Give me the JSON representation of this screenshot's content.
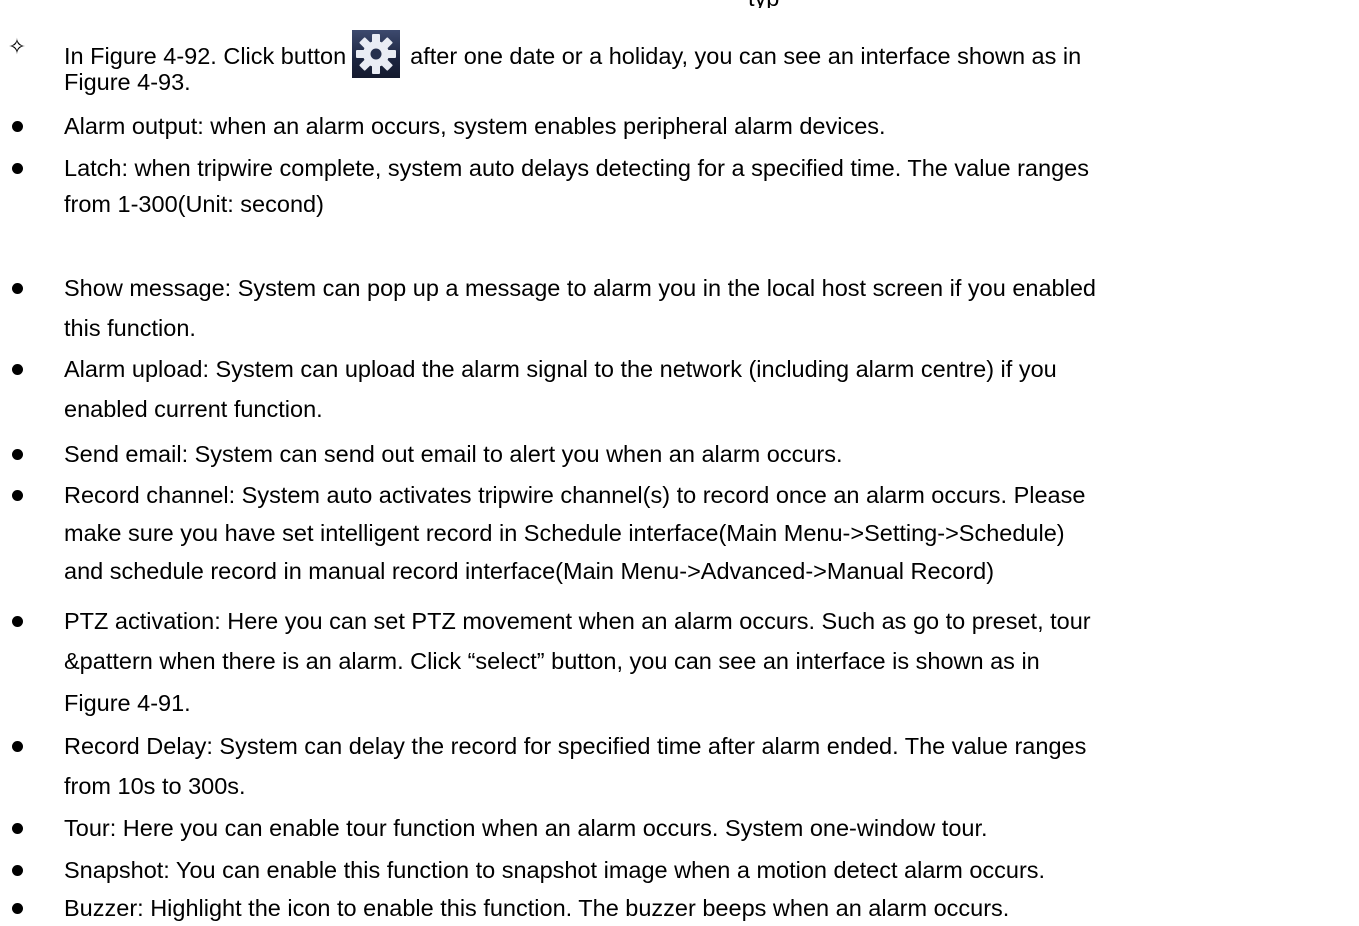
{
  "header_fragment": "typ",
  "intro": {
    "marker": "✧",
    "before_icon": "In Figure 4-92. Click button",
    "icon": "gear-icon",
    "after_icon": "after one date or a holiday, you can see an interface shown as in",
    "line2": "Figure 4-93."
  },
  "items": [
    {
      "line1": "Alarm output: when an alarm occurs, system enables peripheral alarm devices."
    },
    {
      "line1": "Latch: when tripwire complete, system auto delays detecting for a specified time. The value ranges",
      "line2": "from 1-300(Unit: second)"
    },
    {
      "line1": "Show message: System can pop up a message to alarm you in the local host screen if you enabled",
      "line2": "this function."
    },
    {
      "line1": "Alarm upload: System can upload the alarm signal to the network (including alarm centre) if you",
      "line2": "enabled current function."
    },
    {
      "line1": "Send email: System can send out email to alert you when an alarm occurs."
    },
    {
      "line1": "Record channel: System auto activates tripwire channel(s) to record once an alarm occurs. Please",
      "line2": "make sure you have set intelligent record in Schedule interface(Main Menu->Setting->Schedule)",
      "line3": "and schedule record in manual record interface(Main Menu->Advanced->Manual Record)"
    },
    {
      "line1": "PTZ activation: Here you can set PTZ movement when an alarm occurs. Such as go to preset, tour",
      "line2": "&pattern when there is an alarm. Click “select” button, you can see an interface is shown as in",
      "line3": "Figure 4-91."
    },
    {
      "line1": "Record Delay: System can delay the record for specified time after alarm ended. The value ranges",
      "line2": "from 10s to 300s."
    },
    {
      "line1": "Tour: Here you can enable tour function when an alarm occurs. System one-window tour."
    },
    {
      "line1": "Snapshot: You can enable this function to snapshot image when a motion detect alarm occurs."
    },
    {
      "line1": "Buzzer: Highlight the icon to enable this function. The buzzer beeps when an alarm occurs."
    }
  ]
}
